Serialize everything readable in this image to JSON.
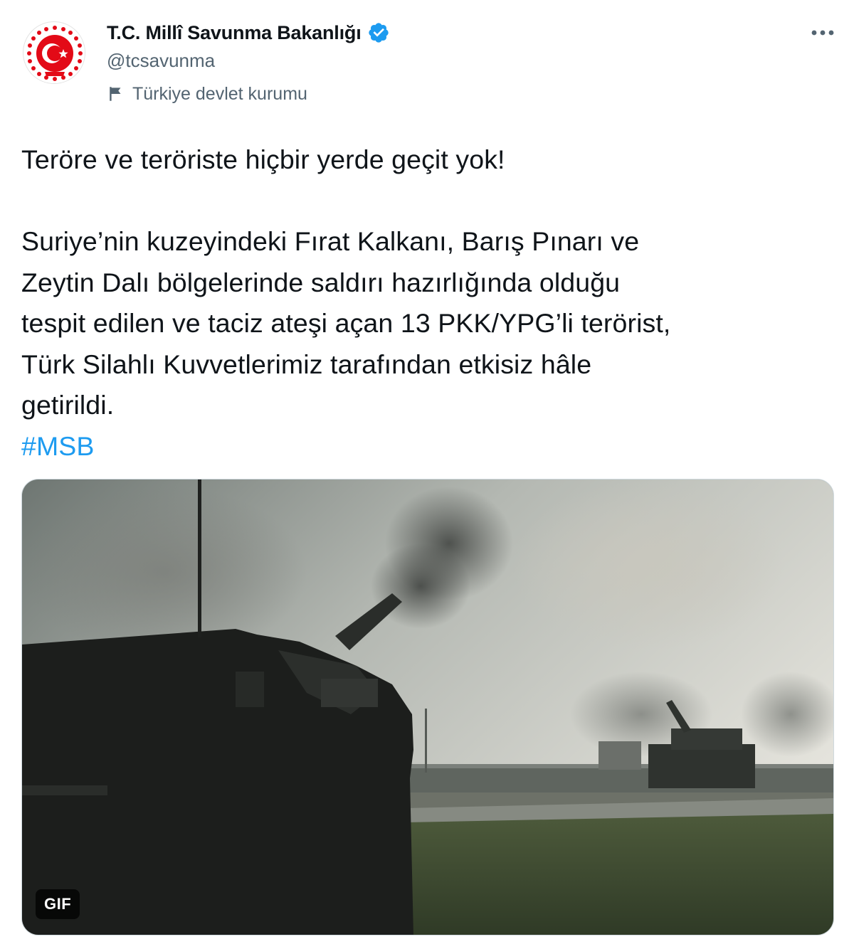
{
  "author": {
    "display_name": "T.C. Millî Savunma Bakanlığı",
    "handle": "@tcsavunma",
    "label": "Türkiye devlet kurumu",
    "verified": true,
    "avatar_icon": "msb-emblem-icon",
    "label_icon": "flag-icon"
  },
  "menu": {
    "more_icon": "more-horizontal-icon"
  },
  "tweet": {
    "lines_p1": [
      "Teröre ve teröriste hiçbir yerde geçit yok!"
    ],
    "lines_p2": [
      "Suriye’nin kuzeyindeki Fırat Kalkanı, Barış Pınarı ve",
      "Zeytin Dalı bölgelerinde saldırı hazırlığında olduğu",
      "tespit edilen ve taciz ateşi açan 13 PKK/YPG’li terörist,",
      "Türk Silahlı Kuvvetlerimiz tarafından etkisiz hâle",
      "getirildi."
    ],
    "hashtag": "#MSB"
  },
  "media": {
    "type": "gif",
    "badge": "GIF",
    "description_icon": "artillery-scene-image"
  },
  "colors": {
    "accent": "#1d9bf0",
    "secondary_text": "#536471",
    "primary_text": "#0f1419",
    "emblem_red": "#e30a17"
  }
}
